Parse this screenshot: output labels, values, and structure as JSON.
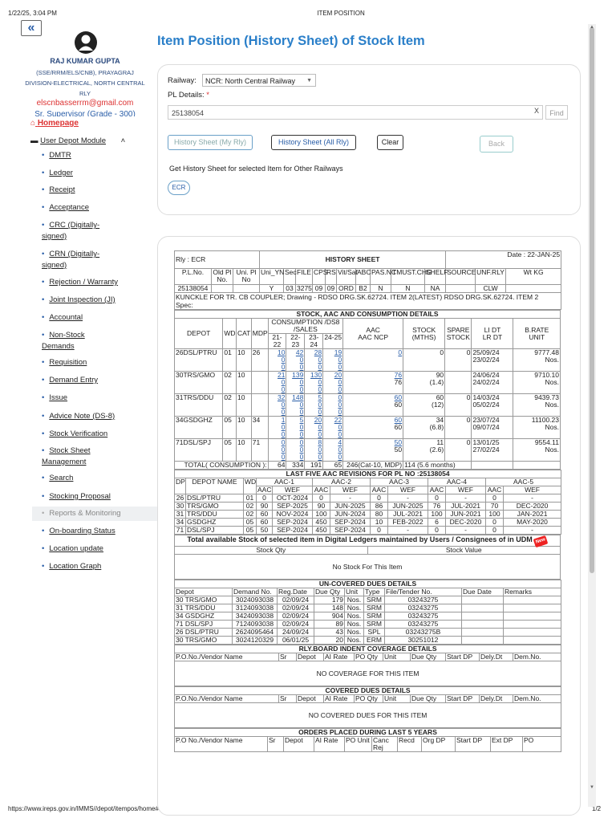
{
  "print_header": {
    "datetime": "1/22/25, 3:04 PM",
    "page_title": "ITEM POSITION"
  },
  "print_footer": {
    "url": "https://www.ireps.gov.in/IMMS//depot/itempos/home#",
    "page_num": "1/2"
  },
  "icons": {
    "back": "double-chevron-left-icon",
    "avatar": "user-avatar-icon",
    "home": "home-icon",
    "module": "depot-icon",
    "collapse": "chevron-up-icon",
    "select": "chevron-down-icon"
  },
  "colors": {
    "accent": "#2a7fc9",
    "link": "#2a5ea8",
    "red": "#d33"
  },
  "user": {
    "name": "RAJ KUMAR GUPTA",
    "designation": "(SSE/RRM/ELS/CNB), PRAYAGRAJ DIVISION-ELECTRICAL, NORTH CENTRAL RLY",
    "email": "elscnbasserrm@gmail.com",
    "role": "Sr. Supervisor (Grade - 300)"
  },
  "sidebar": {
    "home": "Homepage",
    "module": "User Depot Module",
    "items": [
      "DMTR",
      "Ledger",
      "Receipt",
      "Acceptance",
      "CRC (Digitally-signed)",
      "CRN (Digitally-signed)",
      "Rejection / Warranty",
      "Joint Inspection (JI)",
      "Accountal",
      "Non-Stock Demands",
      "Requisition",
      "Demand Entry",
      "Issue",
      "Advice Note (DS-8)",
      "Stock Verification",
      "Stock Sheet Management",
      "Search",
      "Stocking Proposal",
      "Reports & Monitoring",
      "On-boarding Status",
      "Location update",
      "Location Graph"
    ]
  },
  "main": {
    "title": "Item Position (History Sheet) of Stock Item",
    "railway_label": "Railway:",
    "railway_value": "NCR: North Central Railway",
    "pl_label": "PL Details:",
    "required_mark": "*",
    "pl_value": "25138054",
    "clear_x": "X",
    "find": "Find",
    "btn_my_rly": "History Sheet (My Rly)",
    "btn_all_rly": "History Sheet (All Rly)",
    "btn_clear": "Clear",
    "btn_back": "Back",
    "other_rly_text": "Get History Sheet for selected Item for Other Railways",
    "ecr_chip": "ECR"
  },
  "sheet": {
    "rly": "Rly : ECR",
    "title": "HISTORY SHEET",
    "date": "Date : 22-JAN-25",
    "pl_headers": [
      "P.L.No.",
      "Old Pl No.",
      "Uni. Pl No",
      "Uni_YN",
      "Sec",
      "FILE",
      "CPS",
      "RS",
      "Vit/Saf",
      "ABC",
      "PAS.NC",
      "TMUST.CHG",
      "SHELF",
      "SOURCE",
      "UNF.RLY",
      "Wt KG"
    ],
    "pl_values": [
      "25138054",
      "",
      "",
      "Y",
      "03",
      "3275",
      "09",
      "09",
      "ORD",
      "B2",
      "N",
      "N",
      "NA",
      "",
      "CLW",
      ""
    ],
    "description": "KUNCKLE FOR TR. CB COUPLER; Drawing - RDSO DRG.SK.62724. ITEM 2(LATEST) RDSO DRG.SK.62724. ITEM 2",
    "spec": "Spec:",
    "stock_title": "STOCK, AAC AND CONSUMPTION DETAILS",
    "stock_headers": {
      "depot": "DEPOT",
      "wd": "WD",
      "cat": "CAT",
      "mdp": "MDP",
      "consumption": "CONSUMPTION /DS8 /SALES",
      "years": [
        "21-22",
        "22-23",
        "23-24",
        "24-25"
      ],
      "aac": "AAC",
      "aac_ncp": "AAC NCP",
      "stock": "STOCK (MTHS)",
      "spare": "SPARE STOCK",
      "li": "LI DT",
      "lr": "LR DT",
      "brate": "B.RATE",
      "unit": "UNIT"
    },
    "stock_rows": [
      {
        "depot": "26DSL/PTRU",
        "wd": "01",
        "cat": "10",
        "mdp": "26",
        "cons": [
          [
            "10",
            "42",
            "28",
            "19"
          ],
          [
            "0",
            "0",
            "0",
            "0"
          ],
          [
            "0",
            "0",
            "0",
            "0"
          ]
        ],
        "aac": "0",
        "aac_ncp": "",
        "stock": "0",
        "mths": "",
        "spare": "0",
        "li": "25/09/24",
        "lr": "23/02/24",
        "brate": "9777.48",
        "unit": "Nos."
      },
      {
        "depot": "30TRS/GMO",
        "wd": "02",
        "cat": "10",
        "mdp": "",
        "cons": [
          [
            "21",
            "139",
            "130",
            "20"
          ],
          [
            "0",
            "0",
            "0",
            "0"
          ],
          [
            "0",
            "0",
            "0",
            "0"
          ]
        ],
        "aac": "76",
        "aac_ncp": "76",
        "stock": "90",
        "mths": "(1.4)",
        "spare": "",
        "li": "24/06/24",
        "lr": "24/02/24",
        "brate": "9710.10",
        "unit": "Nos."
      },
      {
        "depot": "31TRS/DDU",
        "wd": "02",
        "cat": "10",
        "mdp": "",
        "cons": [
          [
            "32",
            "148",
            "5",
            "0"
          ],
          [
            "0",
            "0",
            "0",
            "0"
          ],
          [
            "0",
            "0",
            "0",
            "0"
          ]
        ],
        "aac": "60",
        "aac_ncp": "60",
        "stock": "60",
        "mths": "(12)",
        "spare": "0",
        "li": "14/03/24",
        "lr": "05/02/24",
        "brate": "9439.73",
        "unit": "Nos."
      },
      {
        "depot": "34GSDGHZ",
        "wd": "05",
        "cat": "10",
        "mdp": "34",
        "cons": [
          [
            "1",
            "5",
            "20",
            "22"
          ],
          [
            "0",
            "0",
            "0",
            "0"
          ],
          [
            "0",
            "0",
            "0",
            "0"
          ]
        ],
        "aac": "60",
        "aac_ncp": "60",
        "stock": "34",
        "mths": "(6.8)",
        "spare": "0",
        "li": "23/07/24",
        "lr": "09/07/24",
        "brate": "11100.23",
        "unit": "Nos."
      },
      {
        "depot": "71DSL/SPJ",
        "wd": "05",
        "cat": "10",
        "mdp": "71",
        "cons": [
          [
            "0",
            "0",
            "8",
            "4"
          ],
          [
            "0",
            "0",
            "0",
            "0"
          ],
          [
            "0",
            "0",
            "0",
            "0"
          ]
        ],
        "aac": "50",
        "aac_ncp": "50",
        "stock": "11",
        "mths": "(2.6)",
        "spare": "0",
        "li": "13/01/25",
        "lr": "27/02/24",
        "brate": "9554.11",
        "unit": "Nos."
      }
    ],
    "total": {
      "label": "TOTAL( CONSUMPTION ):",
      "values": [
        "64",
        "334",
        "191",
        "65"
      ],
      "aac": "246(Cat-10, MDP)",
      "stock": "114 (5.6 months)"
    },
    "aac_title": "LAST FIVE AAC REVISIONS FOR PL NO :25138054",
    "aac_headers": {
      "dp": "DP",
      "depot": "DEPOT NAME",
      "wd": "WD",
      "groups": [
        "AAC-1",
        "AAC-2",
        "AAC-3",
        "AAC-4",
        "AAC-5"
      ],
      "aac": "AAC",
      "wef": "WEF"
    },
    "aac_rows": [
      [
        "26",
        "DSL/PTRU",
        "01",
        "0",
        "OCT-2024",
        "0",
        "-",
        "0",
        "-",
        "0",
        "-",
        "0",
        "-"
      ],
      [
        "30",
        "TRS/GMO",
        "02",
        "90",
        "SEP-2025",
        "90",
        "JUN-2025",
        "86",
        "JUN-2025",
        "76",
        "JUL-2021",
        "70",
        "DEC-2020"
      ],
      [
        "31",
        "TRS/DDU",
        "02",
        "60",
        "NOV-2024",
        "100",
        "JUN-2024",
        "80",
        "JUL-2021",
        "100",
        "JUN-2021",
        "100",
        "JAN-2021"
      ],
      [
        "34",
        "GSDGHZ",
        "05",
        "60",
        "SEP-2024",
        "450",
        "SEP-2024",
        "10",
        "FEB-2022",
        "6",
        "DEC-2020",
        "0",
        "MAY-2020"
      ],
      [
        "71",
        "DSL/SPJ",
        "05",
        "50",
        "SEP-2024",
        "450",
        "SEP-2024",
        "0",
        "-",
        "0",
        "-",
        "0",
        "-"
      ]
    ],
    "udm_title": "Total available Stock of selected item in Digital Ledgers maintained by Users / Consignees of in UDM",
    "new_badge": "New",
    "udm_headers": [
      "Stock Qty",
      "Stock Value"
    ],
    "udm_empty": "No Stock For This Item",
    "uncovered_title": "UN-COVERED DUES DETAILS",
    "uncovered_headers": [
      "Depot",
      "Demand No.",
      "Reg.Date",
      "Due Qty",
      "Unit",
      "Type",
      "File/Tender No.",
      "Due Date",
      "Remarks"
    ],
    "uncovered_rows": [
      [
        "30 TRS/GMO",
        "3024093038",
        "02/09/24",
        "179",
        "Nos.",
        "SRM",
        "03243275",
        "",
        ""
      ],
      [
        "31 TRS/DDU",
        "3124093038",
        "02/09/24",
        "148",
        "Nos.",
        "SRM",
        "03243275",
        "",
        ""
      ],
      [
        "34 GSDGHZ",
        "3424093038",
        "02/09/24",
        "904",
        "Nos.",
        "SRM",
        "03243275",
        "",
        ""
      ],
      [
        "71 DSL/SPJ",
        "7124093038",
        "02/09/24",
        "89",
        "Nos.",
        "SRM",
        "03243275",
        "",
        ""
      ],
      [
        "26 DSL/PTRU",
        "2624095464",
        "24/09/24",
        "43",
        "Nos.",
        "SPL",
        "03243275B",
        "",
        ""
      ],
      [
        "30 TRS/GMO",
        "3024120329",
        "06/01/25",
        "20",
        "Nos.",
        "ERM",
        "30251012",
        "",
        ""
      ]
    ],
    "rly_board_title": "RLY.BOARD INDENT COVERAGE DETAILS",
    "po_headers": [
      "P.O.No./Vendor Name",
      "Sr",
      "Depot",
      "AI Rate",
      "PO Qty",
      "Unit",
      "Due Qty",
      "Start DP",
      "Dely.Dt",
      "Dem.No."
    ],
    "rly_board_empty": "NO COVERAGE FOR THIS ITEM",
    "covered_title": "COVERED DUES DETAILS",
    "covered_empty": "NO COVERED DUES FOR THIS ITEM",
    "orders_title": "ORDERS PLACED DURING LAST 5 YEARS",
    "orders_headers": [
      "P.O No./Vendor Name",
      "Sr",
      "Depot",
      "AI Rate",
      "PO Unit",
      "Canc Rej",
      "Recd",
      "Org DP",
      "Start DP",
      "Ext DP",
      "PO"
    ]
  }
}
